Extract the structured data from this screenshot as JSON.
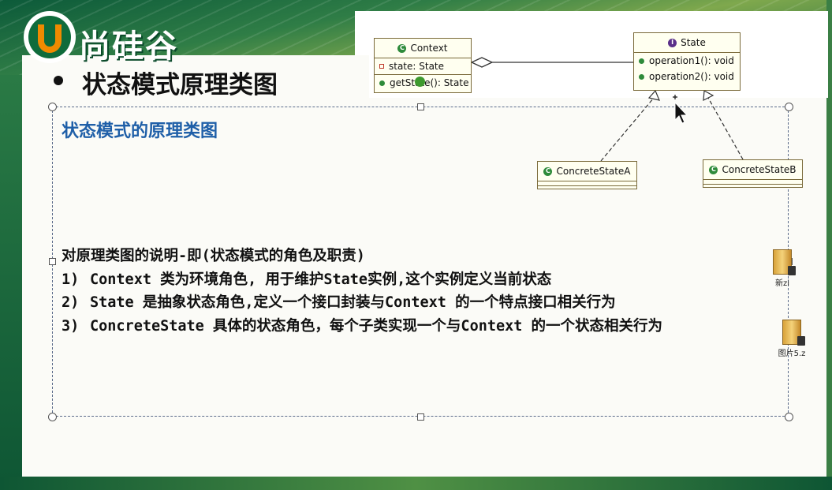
{
  "logo": {
    "text": "尚硅谷"
  },
  "slide": {
    "title": "状态模式原理类图",
    "subtitle": "状态模式的原理类图",
    "explanation": {
      "heading": "对原理类图的说明-即(状态模式的角色及职责)",
      "items": [
        {
          "num": "1)",
          "text": "Context 类为环境角色, 用于维护State实例,这个实例定义当前状态"
        },
        {
          "num": "2)",
          "text": "State 是抽象状态角色,定义一个接口封装与Context 的一个特点接口相关行为"
        },
        {
          "num": "3)",
          "text": "ConcreteState 具体的状态角色，每个子类实现一个与Context 的一个状态相关行为"
        }
      ]
    }
  },
  "uml": {
    "context": {
      "name": "Context",
      "field": "state: State",
      "method": "getState(): State"
    },
    "state": {
      "name": "State",
      "methods": [
        "operation1(): void",
        "operation2(): void"
      ]
    },
    "concrete_a": {
      "name": "ConcreteStateA"
    },
    "concrete_b": {
      "name": "ConcreteStateB"
    }
  },
  "desktop_files": [
    {
      "label": "新zi"
    },
    {
      "label": "图片5.z"
    }
  ],
  "colors": {
    "brand_green": "#0f6b3b",
    "logo_orange": "#f08a00",
    "subtitle_blue": "#1f5fa8"
  }
}
